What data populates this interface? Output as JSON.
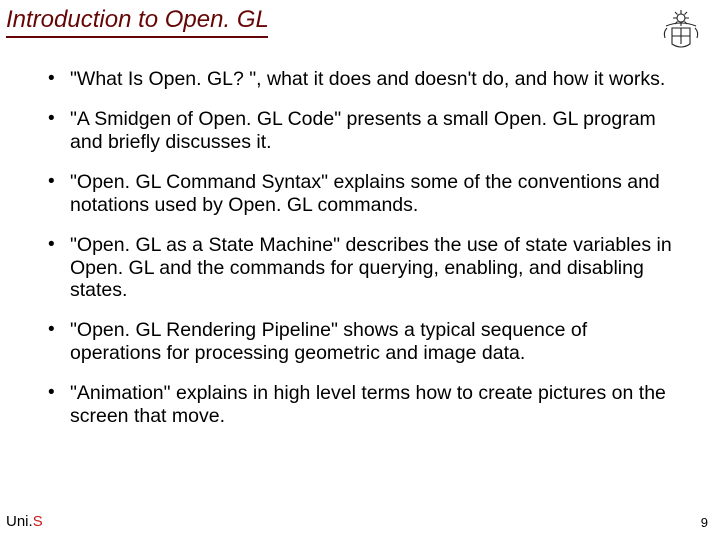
{
  "title": "Introduction to Open. GL",
  "bullets": [
    "\"What Is Open. GL? \", what it does and doesn't do, and how it works.",
    "\"A Smidgen of Open. GL Code\" presents a small Open. GL program and briefly discusses it.",
    "\"Open. GL Command Syntax\" explains some of the conventions and notations used by Open. GL commands.",
    "\"Open. GL as a State Machine\" describes the use of state variables in Open. GL and the commands for querying, enabling, and disabling states.",
    " \"Open. GL Rendering Pipeline\" shows a typical sequence of operations for processing geometric and image data.",
    "\"Animation\" explains in high level terms how to create pictures on the screen that move."
  ],
  "footer": {
    "uni_prefix": "Uni.",
    "uni_suffix": "S",
    "page": "9"
  }
}
